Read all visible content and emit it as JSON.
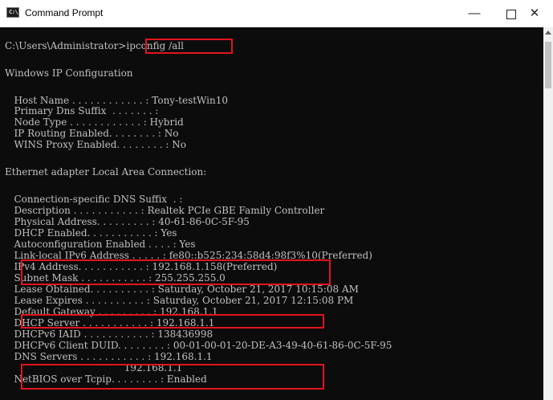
{
  "window": {
    "title": "Command Prompt",
    "icon_text": "C:\\",
    "minimize_glyph": "—",
    "close_glyph": "✕"
  },
  "console": {
    "prompt": "C:\\Users\\Administrator>",
    "command": "ipconfig /all",
    "lines": [
      "Windows IP Configuration",
      "   Host Name . . . . . . . . . . . . : Tony-testWin10",
      "   Primary Dns Suffix  . . . . . . . :",
      "   Node Type . . . . . . . . . . . . : Hybrid",
      "   IP Routing Enabled. . . . . . . . : No",
      "   WINS Proxy Enabled. . . . . . . . : No",
      "Ethernet adapter Local Area Connection:",
      "   Connection-specific DNS Suffix  . :",
      "   Description . . . . . . . . . . . : Realtek PCIe GBE Family Controller",
      "   Physical Address. . . . . . . . . : 40-61-86-0C-5F-95",
      "   DHCP Enabled. . . . . . . . . . . : Yes",
      "   Autoconfiguration Enabled . . . . : Yes",
      "   Link-local IPv6 Address . . . . . : fe80::b525:234:58d4:98f3%10(Preferred)",
      "   IPv4 Address. . . . . . . . . . . : 192.168.1.158(Preferred)",
      "   Subnet Mask . . . . . . . . . . . : 255.255.255.0",
      "   Lease Obtained. . . . . . . . . . : Saturday, October 21, 2017 10:15:08 AM",
      "   Lease Expires . . . . . . . . . . : Saturday, October 21, 2017 12:15:08 PM",
      "   Default Gateway . . . . . . . . . : 192.168.1.1",
      "   DHCP Server . . . . . . . . . . . : 192.168.1.1",
      "   DHCPv6 IAID . . . . . . . . . . . : 138436998",
      "   DHCPv6 Client DUID. . . . . . . . : 00-01-00-01-20-DE-A3-49-40-61-86-0C-5F-95",
      "   DNS Servers . . . . . . . . . . . : 192.168.1.1",
      "                                       192.168.1.1",
      "   NetBIOS over Tcpip. . . . . . . . : Enabled"
    ]
  },
  "colors": {
    "console_bg": "#0c0c0c",
    "console_text": "#c0c0c0",
    "highlight": "#e2141d"
  }
}
